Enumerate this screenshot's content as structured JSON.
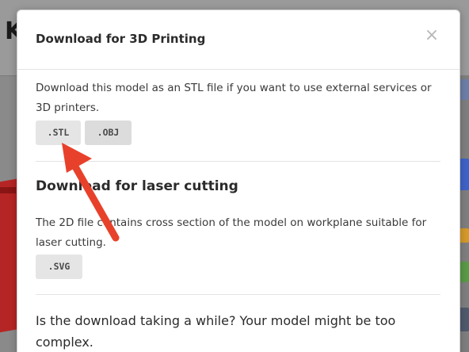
{
  "background": {
    "logo_letter": "K"
  },
  "modal": {
    "title": "Download for 3D Printing",
    "close_glyph": "×",
    "stl_section": {
      "description": "Download this model as an STL file if you want to use external services or 3D printers.",
      "buttons": [
        ".STL",
        ".OBJ"
      ]
    },
    "laser_section": {
      "title": "Download for laser cutting",
      "description": "The 2D file contains cross section of the model on workplane suitable for laser cutting.",
      "buttons": [
        ".SVG"
      ]
    },
    "slow_notice": "Is the download taking a while? Your model might be too complex."
  },
  "colors": {
    "annotation_arrow": "#e8412b",
    "button_bg": "#e5e5e5",
    "text": "#2b2b2b"
  }
}
